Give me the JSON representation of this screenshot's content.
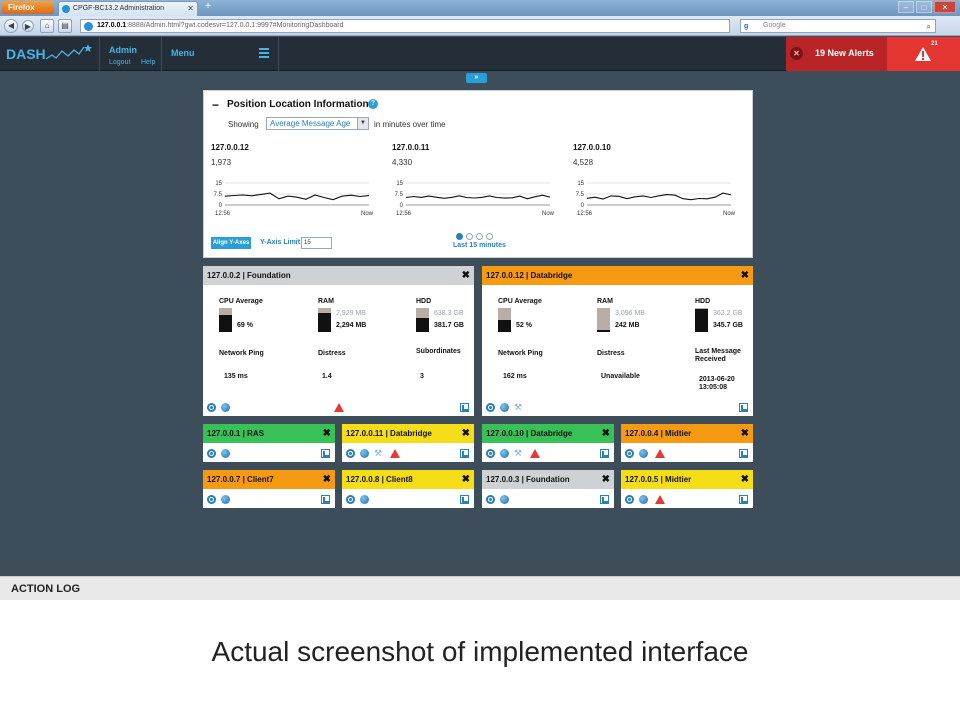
{
  "browser": {
    "app_button": "Firefox",
    "tab_title": "CPGF-BC13.2 Administration",
    "url_host": "127.0.0.1",
    "url_rest": ":8888/Admin.html?gwt.codesvr=127.0.0.1:9997#MonitoringDashboard",
    "search_placeholder": "Google",
    "search_engine": "g"
  },
  "header": {
    "logo": "DASH",
    "user": "Admin",
    "logout": "Logout",
    "help": "Help",
    "menu": "Menu",
    "alerts_text": "19 New Alerts",
    "alert_count": "21"
  },
  "position_panel": {
    "title": "Position Location Information",
    "showing_label": "Showing",
    "metric_select": "Average Message Age",
    "suffix": "in minutes over time",
    "align_button": "Align Y-Axes",
    "y_limit_label": "Y-Axis Limit:",
    "y_limit_value": "15",
    "time_window": "Last 15 minutes",
    "charts": [
      {
        "ip": "127.0.0.12",
        "value": "1,973",
        "ticks": [
          "15",
          "7.5",
          "0"
        ],
        "x_start": "12:56",
        "x_end": "Now",
        "y": [
          6,
          6.5,
          6.8,
          6.3,
          7.2,
          8.1,
          4.2,
          6.1,
          5.3,
          3.9,
          6.8,
          5.1,
          3.6,
          6.0,
          6.7,
          5.8,
          6.4
        ]
      },
      {
        "ip": "127.0.0.11",
        "value": "4,330",
        "ticks": [
          "15",
          "7.5",
          "0"
        ],
        "x_start": "12:56",
        "x_end": "Now",
        "y": [
          5.1,
          5.8,
          5.2,
          6.1,
          5.3,
          4.6,
          5.2,
          6.3,
          5.1,
          4.8,
          5.2,
          6.2,
          5.1,
          4.7,
          4.9,
          6.1,
          4.2,
          5.6,
          6.7,
          5.4
        ]
      },
      {
        "ip": "127.0.0.10",
        "value": "4,528",
        "ticks": [
          "15",
          "7.5",
          "0"
        ],
        "x_start": "12:56",
        "x_end": "Now",
        "y": [
          4.6,
          5.3,
          4.1,
          6.2,
          5.9,
          4.3,
          5.6,
          6.2,
          5.1,
          6.3,
          7.1,
          6.7,
          4.3,
          3.6,
          4.4,
          4.2,
          5.3,
          8.1,
          6.9
        ]
      }
    ]
  },
  "large_nodes": [
    {
      "title": "127.0.0.2 | Foundation",
      "color": "#cfd2d4",
      "cpu_label": "CPU Average",
      "cpu_value": "69 %",
      "cpu_pct": 0.31,
      "ram_label": "RAM",
      "ram_total": "2,929 MB",
      "ram_used": "2,294 MB",
      "ram_free_pct": 0.22,
      "hdd_label": "HDD",
      "hdd_total": "638.3 GB",
      "hdd_used": "381.7 GB",
      "hdd_free_pct": 0.4,
      "ping_label": "Network Ping",
      "ping_value": "135 ms",
      "distress_label": "Distress",
      "distress_value": "1.4",
      "third_label": "Subordinates",
      "third_value": "3",
      "icons": [
        "gear",
        "globe",
        "warn",
        "pop"
      ]
    },
    {
      "title": "127.0.0.12 | Databridge",
      "color": "#f59a12",
      "cpu_label": "CPU Average",
      "cpu_value": "52 %",
      "cpu_pct": 0.48,
      "ram_label": "RAM",
      "ram_total": "3,096 MB",
      "ram_used": "242 MB",
      "ram_free_pct": 0.92,
      "hdd_label": "HDD",
      "hdd_total": "362.2 GB",
      "hdd_used": "345.7 GB",
      "hdd_free_pct": 0.05,
      "ping_label": "Network Ping",
      "ping_value": "162 ms",
      "distress_label": "Distress",
      "distress_value": "Unavailable",
      "third_label": "Last Message Received",
      "third_value": "2013-06-20 13:05:08",
      "icons": [
        "gear",
        "globe",
        "wrench",
        "pop"
      ]
    }
  ],
  "small_nodes": [
    {
      "title": "127.0.0.1 | RAS",
      "color": "#38c156",
      "icons": [
        "gear",
        "globe",
        "pop"
      ]
    },
    {
      "title": "127.0.0.11 | Databridge",
      "color": "#f5dd17",
      "icons": [
        "gear",
        "globe",
        "wrench",
        "warn",
        "pop"
      ]
    },
    {
      "title": "127.0.0.10 | Databridge",
      "color": "#38c156",
      "icons": [
        "gear",
        "globe",
        "wrench",
        "warn",
        "pop"
      ]
    },
    {
      "title": "127.0.0.4 | Midtier",
      "color": "#f59a12",
      "icons": [
        "gear",
        "globe",
        "warn",
        "pop"
      ]
    },
    {
      "title": "127.0.0.7 | Client7",
      "color": "#f59a12",
      "icons": [
        "gear",
        "globe",
        "pop"
      ]
    },
    {
      "title": "127.0.0.8 | Client8",
      "color": "#f5dd17",
      "icons": [
        "gear",
        "globe",
        "pop"
      ]
    },
    {
      "title": "127.0.0.3 | Foundation",
      "color": "#cfd2d4",
      "icons": [
        "gear",
        "globe",
        "pop"
      ]
    },
    {
      "title": "127.0.0.5 | Midtier",
      "color": "#f5dd17",
      "icons": [
        "gear",
        "globe",
        "warn",
        "pop"
      ]
    }
  ],
  "action_log": "ACTION LOG",
  "caption": "Actual screenshot of implemented interface"
}
